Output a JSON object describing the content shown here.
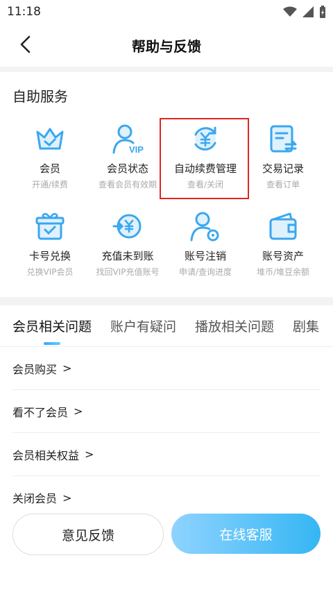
{
  "status_bar": {
    "time": "11:18"
  },
  "nav": {
    "title": "帮助与反馈"
  },
  "self_service": {
    "title": "自助服务",
    "items": [
      {
        "label": "会员",
        "sub": "开通/续费",
        "icon": "crown-icon"
      },
      {
        "label": "会员状态",
        "sub": "查看会员有效期",
        "icon": "vip-user-icon"
      },
      {
        "label": "自动续费管理",
        "sub": "查看/关闭",
        "icon": "auto-renew-yen-icon"
      },
      {
        "label": "交易记录",
        "sub": "查看订单",
        "icon": "transaction-doc-icon"
      },
      {
        "label": "卡号兑换",
        "sub": "兑换VIP会员",
        "icon": "gift-box-icon"
      },
      {
        "label": "充值未到账",
        "sub": "找回VIP充值账号",
        "icon": "recharge-yen-icon"
      },
      {
        "label": "账号注销",
        "sub": "申请/查询进度",
        "icon": "account-cancel-icon"
      },
      {
        "label": "账号资产",
        "sub": "堆币/堆豆余额",
        "icon": "wallet-icon"
      }
    ]
  },
  "tabs": [
    "会员相关问题",
    "账户有疑问",
    "播放相关问题",
    "剧集"
  ],
  "questions": [
    {
      "label": "会员购买",
      "arrow": ">"
    },
    {
      "label": "看不了会员",
      "arrow": ">"
    },
    {
      "label": "会员相关权益",
      "arrow": ">"
    },
    {
      "label": "关闭会员",
      "arrow": ">"
    }
  ],
  "buttons": {
    "feedback": "意见反馈",
    "online_service": "在线客服"
  },
  "colors": {
    "accent_blue": "#35b6f3",
    "highlight_red": "#e02424",
    "icon_blue": "#3aa7ef"
  }
}
